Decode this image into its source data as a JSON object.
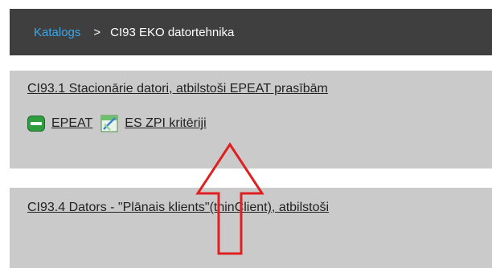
{
  "breadcrumb": {
    "root_label": "Katalogs",
    "separator": ">",
    "current_label": "CI93 EKO datortehnika"
  },
  "items": [
    {
      "title": "CI93.1 Stacionārie datori, atbilstoši EPEAT prasībām",
      "links": [
        {
          "label": "EPEAT",
          "icon": "epeat-badge-icon"
        },
        {
          "label": "ES ZPI kritēriji",
          "icon": "criteria-document-icon"
        }
      ]
    },
    {
      "title": "CI93.4 Dators - \"Plānais klients\"(thinClient), atbilstoši"
    }
  ],
  "colors": {
    "header_bg": "#3f3f3f",
    "link_blue": "#3ba7e8",
    "panel_bg": "#cacaca",
    "arrow_red": "#e02020",
    "epeat_green": "#2e9e3f"
  }
}
